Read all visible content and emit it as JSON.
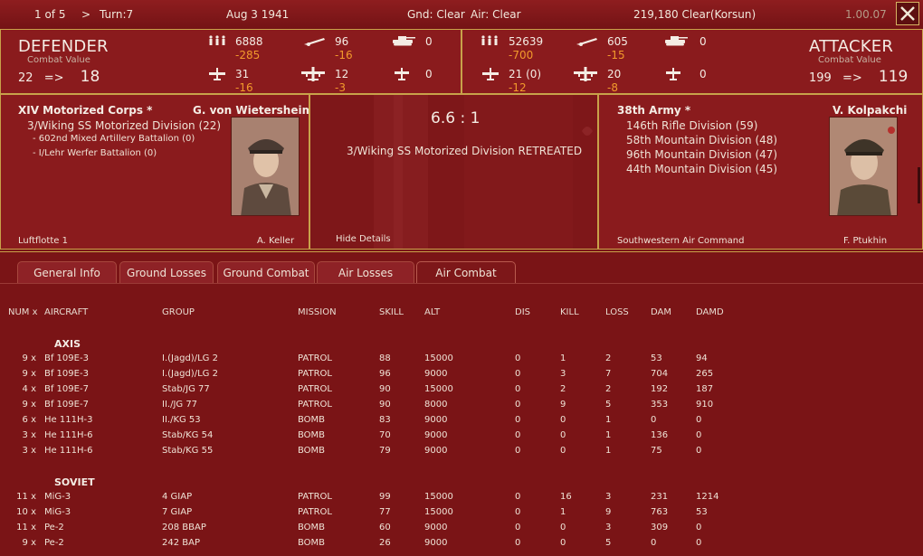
{
  "topbar": {
    "page": "1 of 5",
    "nav_next": ">",
    "turn": "Turn:7",
    "date": "Aug 3 1941",
    "ground_weather": "Gnd: Clear",
    "air_weather": "Air: Clear",
    "location": "219,180  Clear(Korsun)",
    "version": "1.00.07"
  },
  "defender": {
    "title": "DEFENDER",
    "cv_label": "Combat Value",
    "cv_initial": "22",
    "cv_arrow": "=>",
    "cv_final": "18",
    "men": "6888",
    "men_loss": "-285",
    "guns": "96",
    "guns_loss": "-16",
    "afv": "0",
    "fighters": "31",
    "fighters_loss": "-16",
    "bombers": "12",
    "bombers_loss": "-3",
    "other_air": "0",
    "hq": "XIV Motorized Corps *",
    "commander": "G. von Wietersheim",
    "units": [
      "3/Wiking SS Motorized Division (22)"
    ],
    "subunits": [
      "- 602nd Mixed Artillery Battalion (0)",
      "- I/Lehr Werfer Battalion (0)"
    ],
    "air_hq": "Luftflotte 1",
    "air_commander": "A. Keller"
  },
  "attacker": {
    "title": "ATTACKER",
    "cv_label": "Combat Value",
    "cv_initial": "199",
    "cv_arrow": "=>",
    "cv_final": "119",
    "men": "52639",
    "men_loss": "-700",
    "guns": "605",
    "guns_loss": "-15",
    "afv": "0",
    "fighters": "21 (0)",
    "fighters_loss": "-12",
    "bombers": "20",
    "bombers_loss": "-8",
    "other_air": "0",
    "hq": "38th Army *",
    "commander": "V. Kolpakchi",
    "units": [
      "146th Rifle Division (59)",
      "58th Mountain Division (48)",
      "96th Mountain Division (47)",
      "44th Mountain Division (45)"
    ],
    "air_hq": "Southwestern Air Command",
    "air_commander": "F. Ptukhin"
  },
  "result": {
    "ratio": "6.6 : 1",
    "message": "3/Wiking SS Motorized Division RETREATED",
    "hide_details": "Hide Details"
  },
  "tabs": [
    "General Info",
    "Ground Losses",
    "Ground Combat",
    "Air Losses",
    "Air Combat"
  ],
  "active_tab": "Air Combat",
  "table": {
    "headers": [
      "NUM x",
      "AIRCRAFT",
      "GROUP",
      "MISSION",
      "SKILL",
      "ALT",
      "DIS",
      "KILL",
      "LOSS",
      "DAM",
      "DAMD"
    ],
    "sections": [
      {
        "name": "AXIS",
        "rows": [
          [
            "9 x",
            "Bf 109E-3",
            "I.(Jagd)/LG 2",
            "PATROL",
            "88",
            "15000",
            "0",
            "1",
            "2",
            "53",
            "94"
          ],
          [
            "9 x",
            "Bf 109E-3",
            "I.(Jagd)/LG 2",
            "PATROL",
            "96",
            "9000",
            "0",
            "3",
            "7",
            "704",
            "265"
          ],
          [
            "4 x",
            "Bf 109E-7",
            "Stab/JG 77",
            "PATROL",
            "90",
            "15000",
            "0",
            "2",
            "2",
            "192",
            "187"
          ],
          [
            "9 x",
            "Bf 109E-7",
            "II./JG 77",
            "PATROL",
            "90",
            "8000",
            "0",
            "9",
            "5",
            "353",
            "910"
          ],
          [
            "6 x",
            "He 111H-3",
            "II./KG 53",
            "BOMB",
            "83",
            "9000",
            "0",
            "0",
            "1",
            "0",
            "0"
          ],
          [
            "3 x",
            "He 111H-6",
            "Stab/KG 54",
            "BOMB",
            "70",
            "9000",
            "0",
            "0",
            "1",
            "136",
            "0"
          ],
          [
            "3 x",
            "He 111H-6",
            "Stab/KG 55",
            "BOMB",
            "79",
            "9000",
            "0",
            "0",
            "1",
            "75",
            "0"
          ]
        ]
      },
      {
        "name": "SOVIET",
        "rows": [
          [
            "11 x",
            "MiG-3",
            "4 GIAP",
            "PATROL",
            "99",
            "15000",
            "0",
            "16",
            "3",
            "231",
            "1214"
          ],
          [
            "10 x",
            "MiG-3",
            "7 GIAP",
            "PATROL",
            "77",
            "15000",
            "0",
            "1",
            "9",
            "763",
            "53"
          ],
          [
            "11 x",
            "Pe-2",
            "208 BBAP",
            "BOMB",
            "60",
            "9000",
            "0",
            "0",
            "3",
            "309",
            "0"
          ],
          [
            "9 x",
            "Pe-2",
            "242 BAP",
            "BOMB",
            "26",
            "9000",
            "0",
            "0",
            "5",
            "0",
            "0"
          ]
        ]
      }
    ]
  }
}
